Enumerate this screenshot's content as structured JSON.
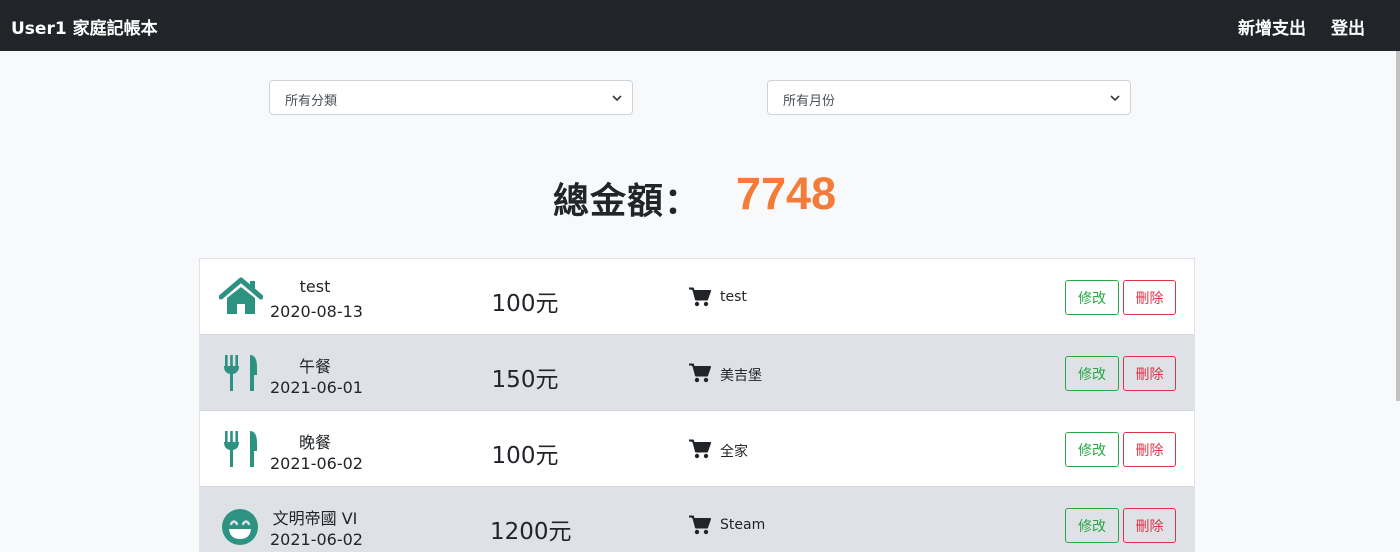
{
  "navbar": {
    "brand": "User1 家庭記帳本",
    "add_label": "新增支出",
    "logout_label": "登出"
  },
  "filters": {
    "category": {
      "selected": "所有分類"
    },
    "month": {
      "selected": "所有月份"
    }
  },
  "summary": {
    "label": "總金額：",
    "value": "7748"
  },
  "records": [
    {
      "icon": "home-icon",
      "name": "test",
      "date": "2020-08-13",
      "amount": "100元",
      "note": "test",
      "edit_label": "修改",
      "delete_label": "刪除"
    },
    {
      "icon": "utensils-icon",
      "name": "午餐",
      "date": "2021-06-01",
      "amount": "150元",
      "note": "美吉堡",
      "edit_label": "修改",
      "delete_label": "刪除"
    },
    {
      "icon": "utensils-icon",
      "name": "晚餐",
      "date": "2021-06-02",
      "amount": "100元",
      "note": "全家",
      "edit_label": "修改",
      "delete_label": "刪除"
    },
    {
      "icon": "grin-icon",
      "name": "文明帝國 VI",
      "date": "2021-06-02",
      "amount": "1200元",
      "note": "Steam",
      "edit_label": "修改",
      "delete_label": "刪除"
    }
  ],
  "colors": {
    "icon": "#2e9283",
    "total": "#f57c38",
    "edit": "#28a745",
    "delete": "#dc3545",
    "navbar": "#212529"
  }
}
